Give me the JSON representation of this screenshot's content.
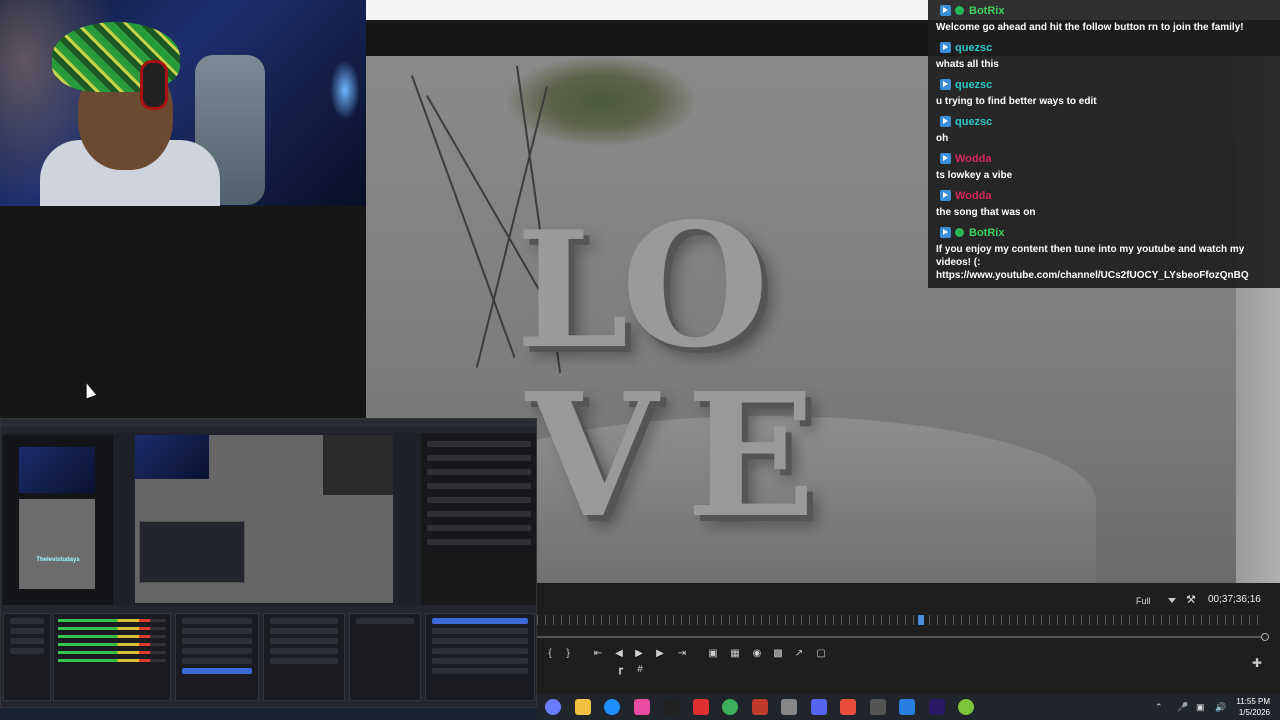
{
  "chat": {
    "messages": [
      {
        "user": "BotRix",
        "color": "#3fd15f",
        "verified": true,
        "text": "Welcome go ahead and hit the follow button rn to join the family!"
      },
      {
        "user": "quezsc",
        "color": "#2ec7c7",
        "verified": false,
        "text": "whats all this"
      },
      {
        "user": "quezsc",
        "color": "#2ec7c7",
        "verified": false,
        "text": "u trying to find better ways to edit"
      },
      {
        "user": "quezsc",
        "color": "#2ec7c7",
        "verified": false,
        "text": "oh"
      },
      {
        "user": "Wodda",
        "color": "#d6285a",
        "verified": false,
        "text": "ts lowkey a vibe"
      },
      {
        "user": "Wodda",
        "color": "#d6285a",
        "verified": false,
        "text": "the song that was on"
      },
      {
        "user": "BotRix",
        "color": "#3fd15f",
        "verified": true,
        "text": "If you enjoy my content then tune into my youtube and watch my videos! (: https://www.youtube.com/channel/UCs2fUOCY_LYsbeoFfozQnBQ"
      }
    ]
  },
  "player": {
    "quality": "Full",
    "timecode": "00;37;36;16",
    "playhead_fraction": 0.524
  },
  "preview": {
    "sculpture_letters": [
      "L",
      "O",
      "V",
      "E"
    ]
  },
  "obs": {
    "scene_art_label": "Thelevistudays"
  },
  "taskbar": {
    "time": "11:55 PM",
    "date": "1/5/2026",
    "icons": [
      "copilot-icon",
      "file-explorer-icon",
      "edge-icon",
      "instagram-icon",
      "nzxt-icon",
      "opera-icon",
      "chrome-icon",
      "app-icon",
      "settings-icon",
      "discord-icon",
      "app2-icon",
      "obs-icon",
      "photos-icon",
      "premiere-icon",
      "xbox-icon"
    ]
  }
}
